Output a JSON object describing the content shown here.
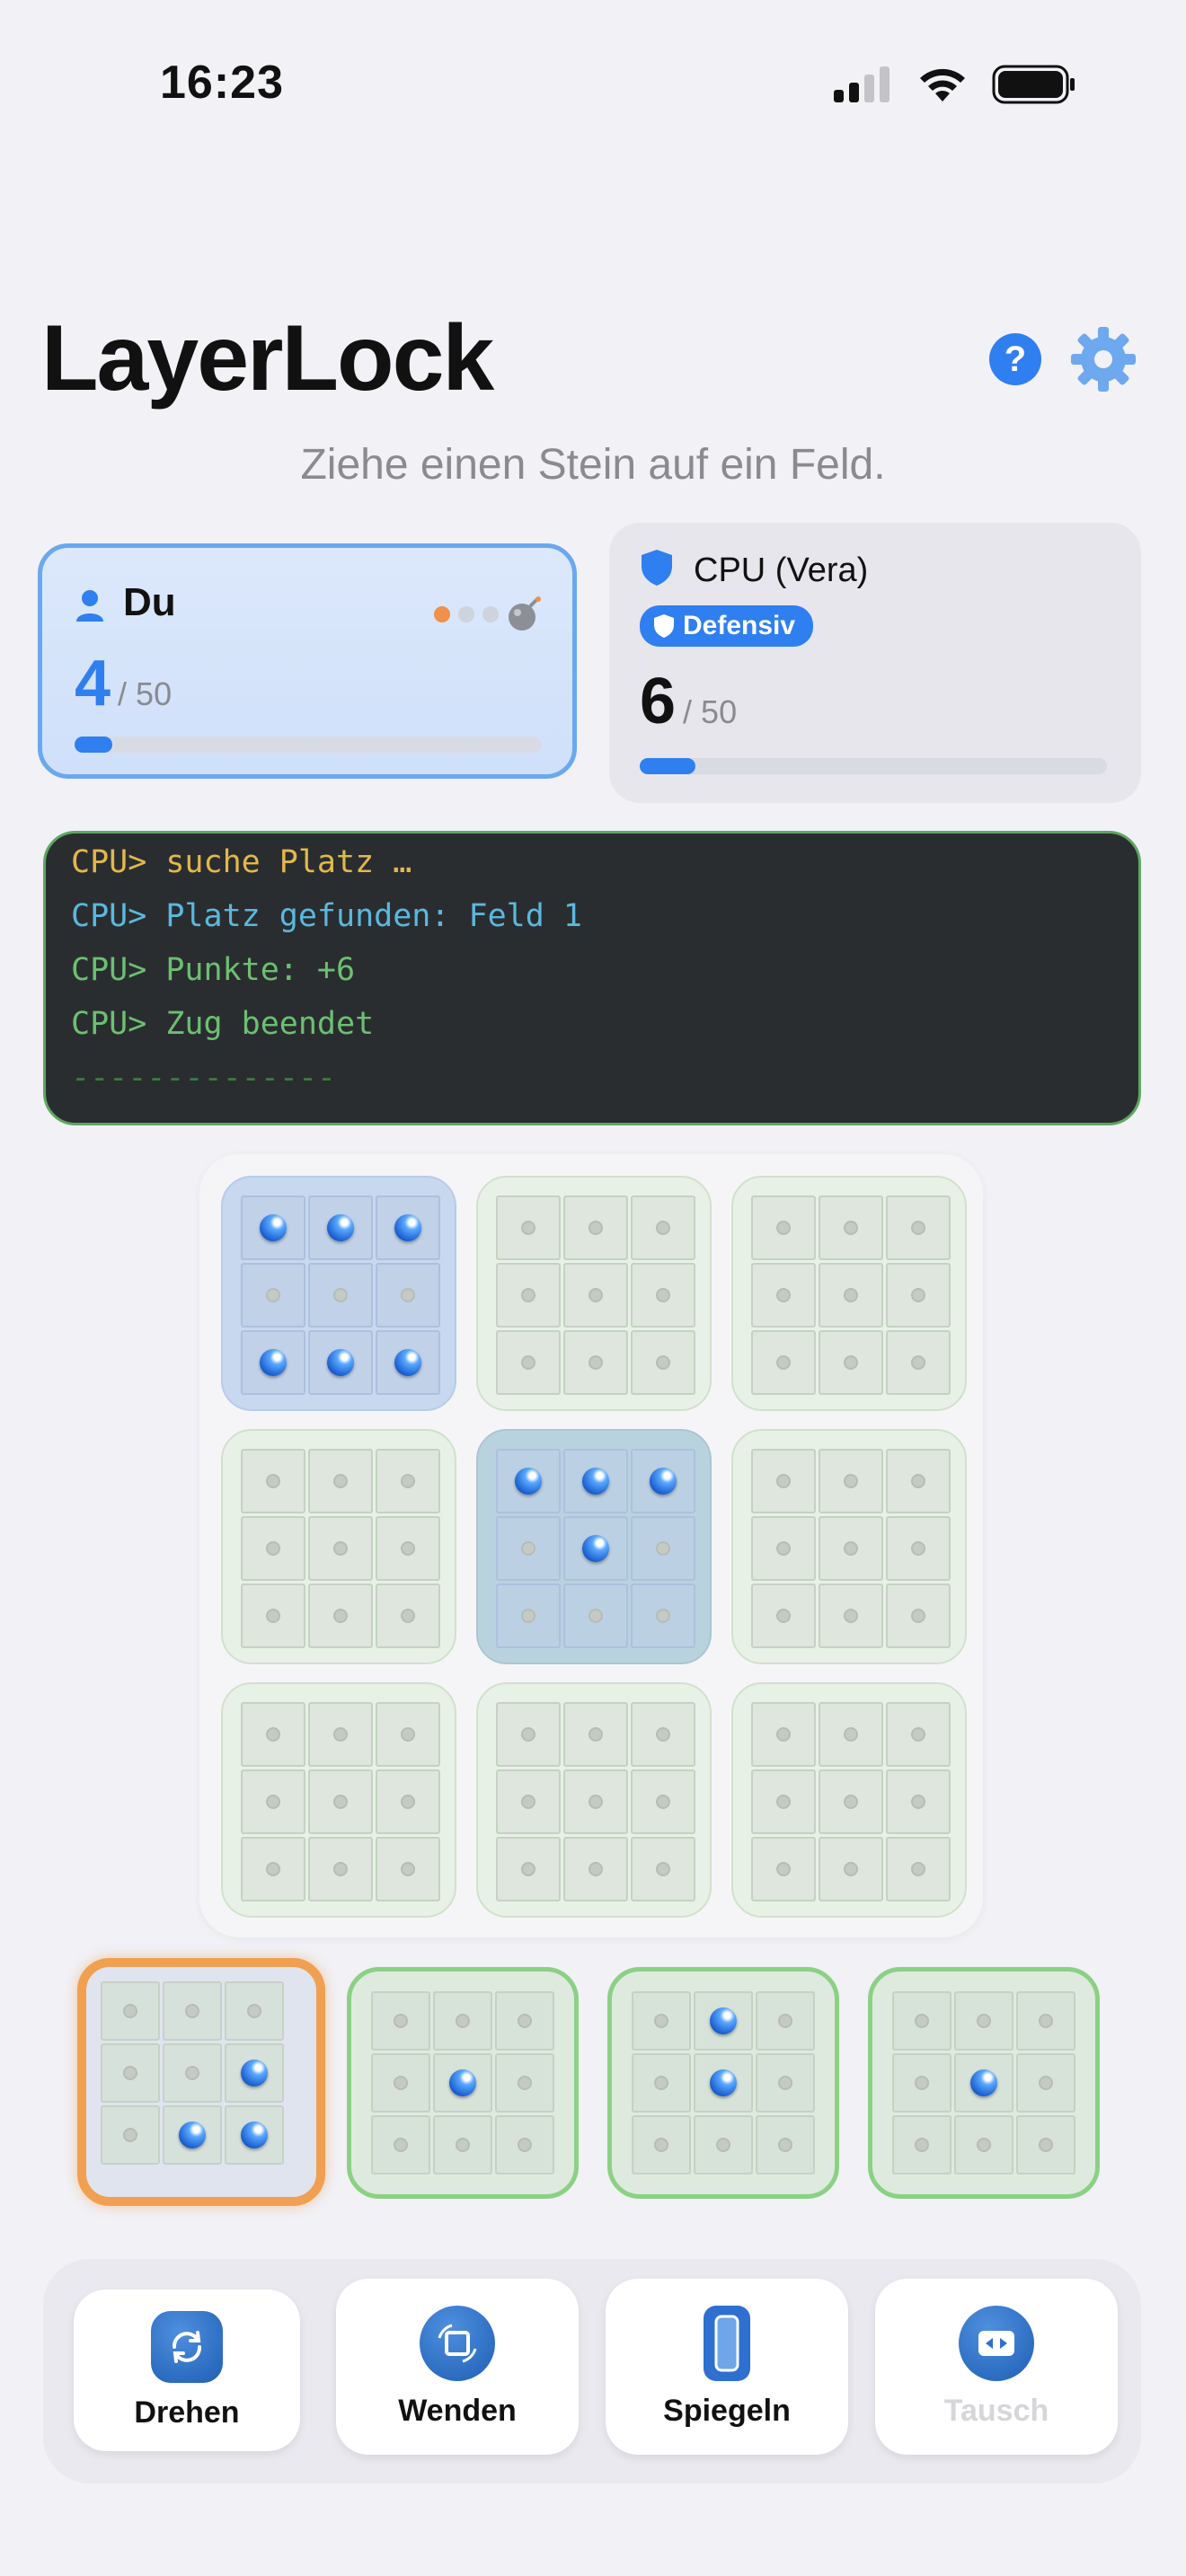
{
  "status_bar": {
    "time": "16:23"
  },
  "header": {
    "title": "LayerLock",
    "help_label": "?"
  },
  "hint": "Ziehe einen Stein auf ein Feld.",
  "players": {
    "you": {
      "name": "Du",
      "score": "4",
      "max": "/ 50",
      "progress": 0.08,
      "active": true
    },
    "cpu": {
      "name": "CPU (Vera)",
      "badge": "Defensiv",
      "score": "6",
      "max": "/ 50",
      "progress": 0.12
    }
  },
  "console": {
    "lines": [
      {
        "text": "CPU> suche Platz …",
        "color": "#e2b84b"
      },
      {
        "text": "CPU> Platz gefunden: Feld 1",
        "color": "#5bb8de"
      },
      {
        "text": "CPU> Punkte: +6",
        "color": "#6cc070"
      },
      {
        "text": "CPU> Zug beendet",
        "color": "#6cc070"
      },
      {
        "text": "--------------",
        "color": "#3f7a44"
      }
    ]
  },
  "board": {
    "subboards": [
      {
        "tint": "blue",
        "balls": [
          1,
          1,
          1,
          0,
          0,
          0,
          1,
          1,
          1
        ]
      },
      {
        "tint": "green",
        "balls": [
          0,
          0,
          0,
          0,
          0,
          0,
          0,
          0,
          0
        ]
      },
      {
        "tint": "green",
        "balls": [
          0,
          0,
          0,
          0,
          0,
          0,
          0,
          0,
          0
        ]
      },
      {
        "tint": "green",
        "balls": [
          0,
          0,
          0,
          0,
          0,
          0,
          0,
          0,
          0
        ]
      },
      {
        "tint": "teal",
        "balls": [
          1,
          1,
          1,
          0,
          1,
          0,
          0,
          0,
          0
        ]
      },
      {
        "tint": "green",
        "balls": [
          0,
          0,
          0,
          0,
          0,
          0,
          0,
          0,
          0
        ]
      },
      {
        "tint": "green",
        "balls": [
          0,
          0,
          0,
          0,
          0,
          0,
          0,
          0,
          0
        ]
      },
      {
        "tint": "green",
        "balls": [
          0,
          0,
          0,
          0,
          0,
          0,
          0,
          0,
          0
        ]
      },
      {
        "tint": "green",
        "balls": [
          0,
          0,
          0,
          0,
          0,
          0,
          0,
          0,
          0
        ]
      }
    ]
  },
  "tray": {
    "pieces": [
      {
        "selected": true,
        "balls": [
          0,
          0,
          0,
          0,
          0,
          1,
          0,
          1,
          1
        ]
      },
      {
        "selected": false,
        "balls": [
          0,
          0,
          0,
          0,
          1,
          0,
          0,
          0,
          0
        ]
      },
      {
        "selected": false,
        "balls": [
          0,
          1,
          0,
          0,
          1,
          0,
          0,
          0,
          0
        ]
      },
      {
        "selected": false,
        "balls": [
          0,
          0,
          0,
          0,
          1,
          0,
          0,
          0,
          0
        ]
      }
    ]
  },
  "toolbar": {
    "rotate_label": "Drehen",
    "flip_label": "Wenden",
    "mirror_label": "Spiegeln",
    "swap_label": "Tausch",
    "swap_disabled": true
  },
  "colors": {
    "accent": "#2f7ff0",
    "selected_border": "#f0a050",
    "console_bg": "#2a2d30"
  }
}
